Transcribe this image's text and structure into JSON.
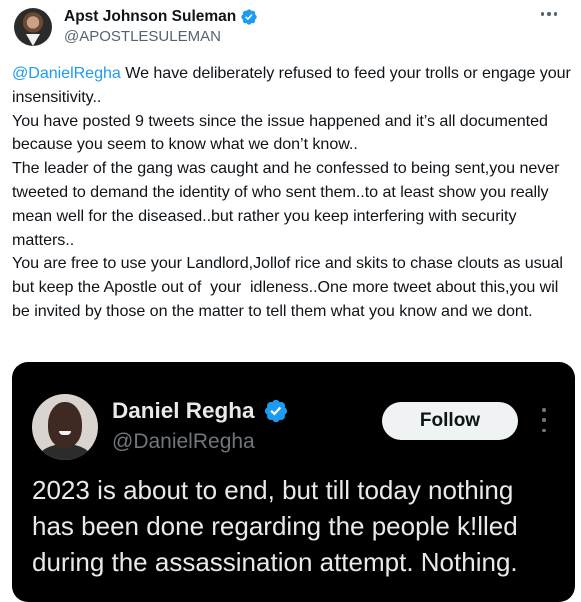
{
  "tweet": {
    "author_name": "Apst Johnson Suleman",
    "author_handle": "@APOSTLESULEMAN",
    "mention": "@DanielRegha",
    "body": " We have deliberately refused to feed your trolls or engage your insensitivity..\nYou have posted 9 tweets since the issue happened and it’s all documented because you seem to know what we don’t know..\nThe leader of the gang was caught and he confessed to being sent,you never tweeted to demand the identity of who sent them..to at least show you really mean well for the diseased..but rather you keep interfering with security matters..\nYou are free to use your Landlord,Jollof rice and skits to chase clouts as usual but keep the Apostle out of  your  idleness..One more tweet about this,you wil be invited by those on the matter to tell them what you know and we dont."
  },
  "quoted": {
    "author_name": "Daniel Regha",
    "author_handle": "@DanielRegha",
    "follow_label": "Follow",
    "text": "2023 is about to end, but till today nothing has been done regarding the people k!lled during the assassination attempt. Nothing."
  },
  "colors": {
    "link": "#1d9bf0",
    "verified": "#1d9bf0",
    "quote_bg": "#000000"
  },
  "icons": [
    "verified-badge-icon",
    "more-options-icon"
  ]
}
